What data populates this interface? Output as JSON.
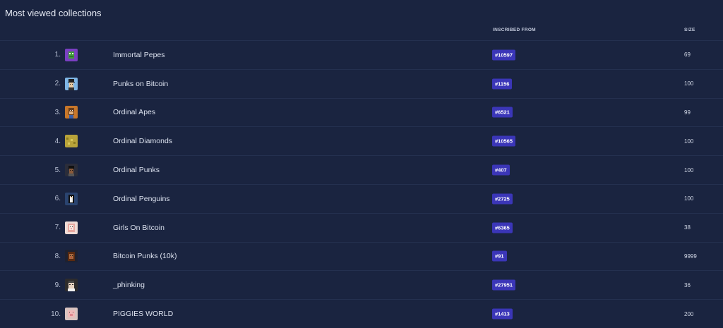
{
  "section": {
    "title": "Most viewed collections",
    "headers": {
      "inscribed_from": "INSCRIBED FROM",
      "size": "SIZE"
    }
  },
  "collections": [
    {
      "rank": "1.",
      "name": "Immortal Pepes",
      "inscribed_from": "#10597",
      "size": "69",
      "icon": "pepe-frog-avatar",
      "color": "#7a3fc2"
    },
    {
      "rank": "2.",
      "name": "Punks on Bitcoin",
      "inscribed_from": "#1156",
      "size": "100",
      "icon": "top-hat-punk-avatar",
      "color": "#7fb6e6"
    },
    {
      "rank": "3.",
      "name": "Ordinal Apes",
      "inscribed_from": "#6521",
      "size": "99",
      "icon": "ape-avatar",
      "color": "#c8772a"
    },
    {
      "rank": "4.",
      "name": "Ordinal Diamonds",
      "inscribed_from": "#10565",
      "size": "100",
      "icon": "diamond-avatar",
      "color": "#b8a33a"
    },
    {
      "rank": "5.",
      "name": "Ordinal Punks",
      "inscribed_from": "#407",
      "size": "100",
      "icon": "dark-punk-avatar",
      "color": "#2b2d3a"
    },
    {
      "rank": "6.",
      "name": "Ordinal Penguins",
      "inscribed_from": "#2725",
      "size": "100",
      "icon": "penguin-avatar",
      "color": "#2a4470"
    },
    {
      "rank": "7.",
      "name": "Girls On Bitcoin",
      "inscribed_from": "#6365",
      "size": "38",
      "icon": "girl-avatar",
      "color": "#f0dcd6"
    },
    {
      "rank": "8.",
      "name": "Bitcoin Punks (10k)",
      "inscribed_from": "#91",
      "size": "9999",
      "icon": "bitcoin-punk-avatar",
      "color": "#1e2130"
    },
    {
      "rank": "9.",
      "name": "_phinking",
      "inscribed_from": "#27951",
      "size": "36",
      "icon": "phinking-avatar",
      "color": "#2e2c2c"
    },
    {
      "rank": "10.",
      "name": "PIGGIES WORLD",
      "inscribed_from": "#1413",
      "size": "200",
      "icon": "piggy-avatar",
      "color": "#d9c3c0"
    }
  ]
}
